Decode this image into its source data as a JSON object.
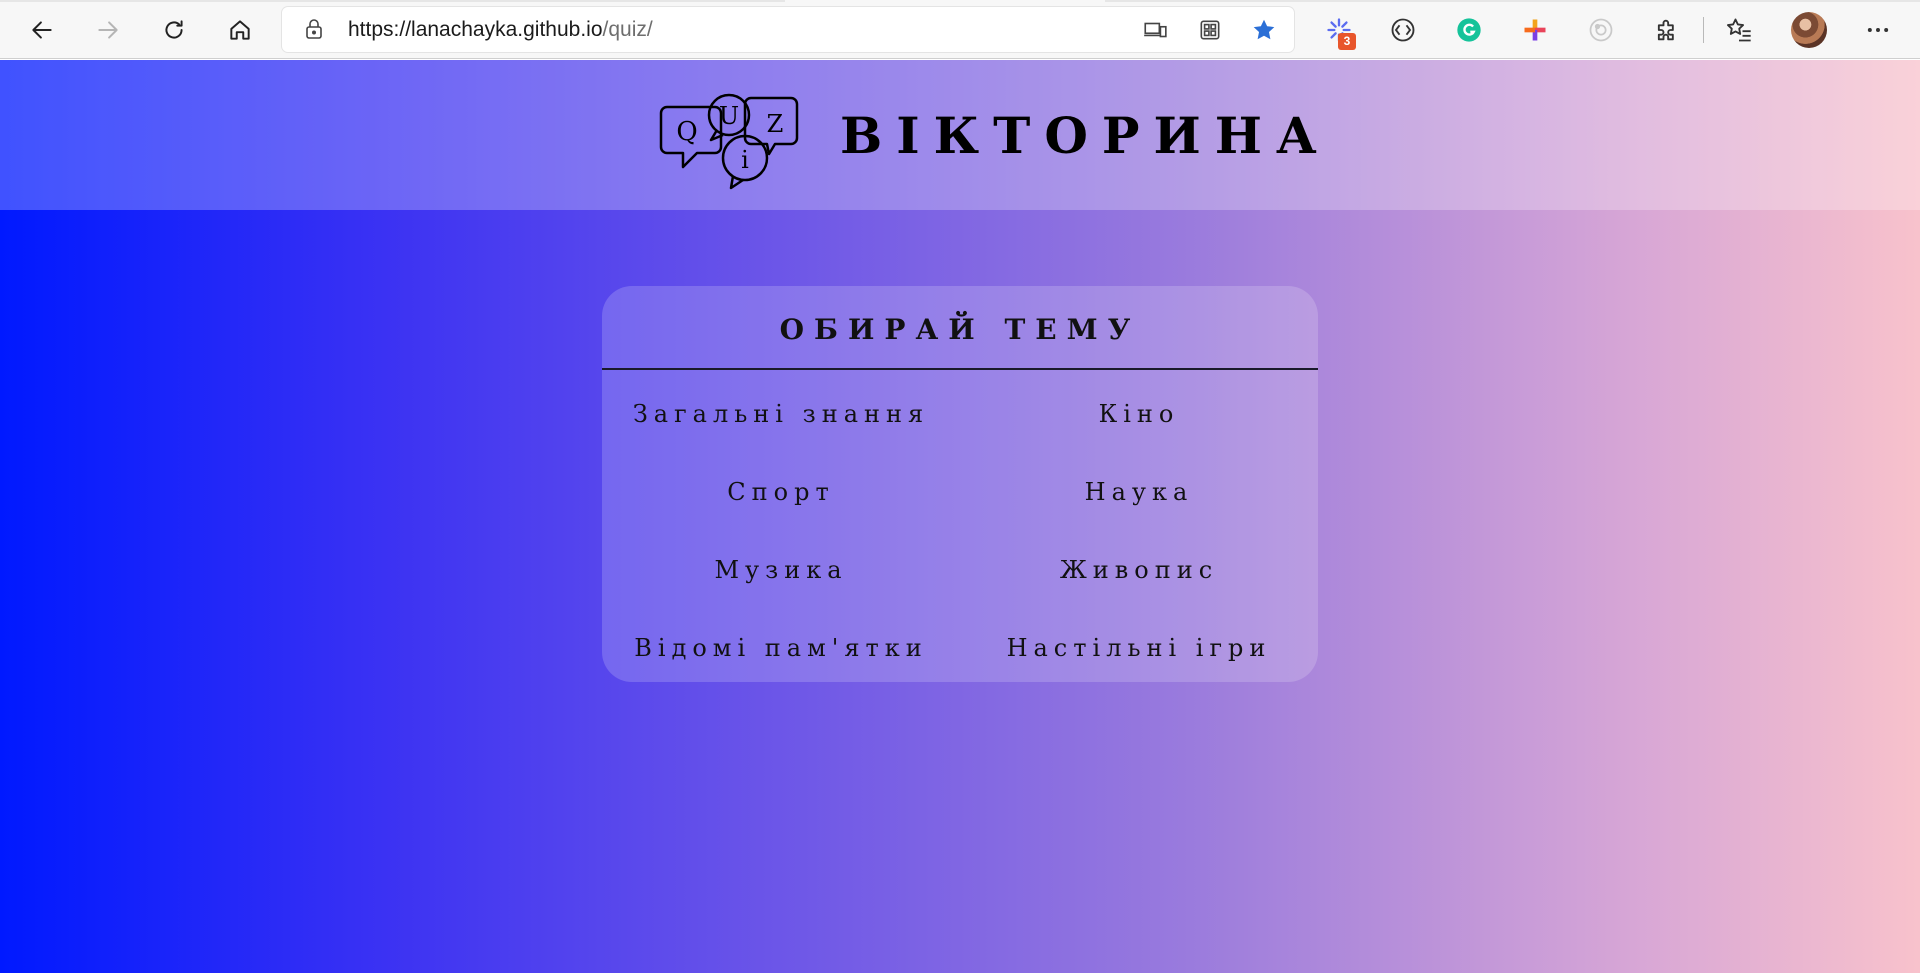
{
  "browser": {
    "url_host": "https://lanachayka.github.io",
    "url_path": "/quiz/",
    "extension_badge": "3",
    "icons": [
      "back-arrow-icon",
      "forward-arrow-icon",
      "refresh-icon",
      "home-icon",
      "lock-icon",
      "devices-icon",
      "apps-grid-icon",
      "favorite-star-icon",
      "extension-sparkle-icon",
      "extension-brackets-icon",
      "grammarly-icon",
      "extension-plus-icon",
      "extension-circle-icon",
      "extensions-puzzle-icon",
      "favorites-list-icon",
      "profile-avatar",
      "more-menu-icon"
    ],
    "accent_star": "#2b6fd6"
  },
  "header": {
    "title": "ВІКТОРИНА",
    "logo_letters": [
      "Q",
      "U",
      "Z",
      "i"
    ]
  },
  "card": {
    "title": "ОБИРАЙ ТЕМУ",
    "topics": [
      "Загальні знання",
      "Кіно",
      "Спорт",
      "Наука",
      "Музика",
      "Живопис",
      "Відомі пам'ятки",
      "Настільні ігри"
    ]
  },
  "colors": {
    "gradient_start": "#0019ff",
    "gradient_end": "#f8c2cc"
  }
}
